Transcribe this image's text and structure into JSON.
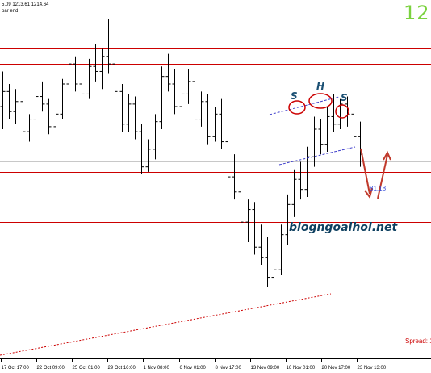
{
  "header": {
    "ohlc_text": "5.09 1213.61 1214.64",
    "bar_end_label": "bar end",
    "timer_text": "12"
  },
  "watermark_text": "blogngoaihoi.net",
  "spread_text": "Spread: 1",
  "pattern_labels": {
    "left_shoulder": "S",
    "head": "H",
    "right_shoulder": "S"
  },
  "price_tag": "81.18",
  "colors": {
    "background": "#ffffff",
    "bar": "#000000",
    "support_resistance": "#cc0000",
    "neckline": "#4040cc",
    "arrow": "#c0392b",
    "timer": "#7bd23f",
    "watermark": "#0d3f5f"
  },
  "chart_data": {
    "type": "ohlc",
    "title": "",
    "xlabel": "",
    "ylabel": "",
    "x_tick_labels": [
      "17 Oct 17:00",
      "22 Oct 09:00",
      "25 Oct 01:00",
      "29 Oct 16:00",
      "1 Nov 08:00",
      "6 Nov 01:00",
      "8 Nov 17:00",
      "13 Nov 09:00",
      "16 Nov 01:00",
      "20 Nov 17:00",
      "23 Nov 13:00"
    ],
    "horizontal_levels": [
      1232,
      1226,
      1214,
      1199,
      1183,
      1163,
      1149,
      1134
    ],
    "current_price_line": 1187,
    "ylim": [
      1110,
      1245
    ],
    "pattern": "head and shoulders",
    "series": [
      {
        "values": [
          [
            1209,
            1223,
            1200,
            1215
          ],
          [
            1215,
            1218,
            1204,
            1207
          ],
          [
            1207,
            1216,
            1202,
            1211
          ],
          [
            1211,
            1213,
            1196,
            1199
          ],
          [
            1199,
            1206,
            1195,
            1204
          ],
          [
            1204,
            1216,
            1201,
            1213
          ],
          [
            1213,
            1219,
            1207,
            1210
          ],
          [
            1210,
            1212,
            1198,
            1201
          ],
          [
            1201,
            1209,
            1198,
            1206
          ],
          [
            1206,
            1220,
            1204,
            1218
          ],
          [
            1218,
            1230,
            1213,
            1226
          ],
          [
            1226,
            1229,
            1215,
            1218
          ],
          [
            1218,
            1222,
            1211,
            1214
          ],
          [
            1214,
            1228,
            1212,
            1225
          ],
          [
            1225,
            1234,
            1219,
            1223
          ],
          [
            1223,
            1232,
            1216,
            1229
          ],
          [
            1229,
            1244,
            1222,
            1226
          ],
          [
            1226,
            1231,
            1212,
            1215
          ],
          [
            1215,
            1218,
            1199,
            1202
          ],
          [
            1202,
            1214,
            1199,
            1210
          ],
          [
            1210,
            1213,
            1196,
            1199
          ],
          [
            1199,
            1202,
            1182,
            1185
          ],
          [
            1185,
            1196,
            1183,
            1192
          ],
          [
            1192,
            1206,
            1188,
            1203
          ],
          [
            1203,
            1225,
            1200,
            1221
          ],
          [
            1221,
            1230,
            1215,
            1218
          ],
          [
            1218,
            1224,
            1206,
            1209
          ],
          [
            1209,
            1217,
            1204,
            1214
          ],
          [
            1214,
            1224,
            1210,
            1219
          ],
          [
            1219,
            1222,
            1200,
            1204
          ],
          [
            1204,
            1215,
            1201,
            1211
          ],
          [
            1211,
            1214,
            1194,
            1197
          ],
          [
            1197,
            1209,
            1195,
            1206
          ],
          [
            1206,
            1212,
            1192,
            1195
          ],
          [
            1195,
            1198,
            1178,
            1181
          ],
          [
            1181,
            1190,
            1172,
            1175
          ],
          [
            1175,
            1178,
            1160,
            1163
          ],
          [
            1163,
            1172,
            1155,
            1168
          ],
          [
            1168,
            1171,
            1150,
            1153
          ],
          [
            1153,
            1162,
            1146,
            1149
          ],
          [
            1149,
            1157,
            1137,
            1141
          ],
          [
            1141,
            1148,
            1133,
            1144
          ],
          [
            1144,
            1162,
            1142,
            1158
          ],
          [
            1158,
            1174,
            1154,
            1170
          ],
          [
            1170,
            1184,
            1165,
            1180
          ],
          [
            1180,
            1187,
            1172,
            1176
          ],
          [
            1176,
            1193,
            1173,
            1189
          ],
          [
            1189,
            1205,
            1185,
            1200
          ],
          [
            1200,
            1204,
            1190,
            1194
          ],
          [
            1194,
            1209,
            1191,
            1205
          ],
          [
            1205,
            1214,
            1199,
            1202
          ],
          [
            1202,
            1212,
            1200,
            1210
          ],
          [
            1210,
            1213,
            1201,
            1206
          ],
          [
            1206,
            1210,
            1193,
            1197
          ],
          [
            1197,
            1203,
            1185,
            1190
          ]
        ]
      }
    ]
  }
}
